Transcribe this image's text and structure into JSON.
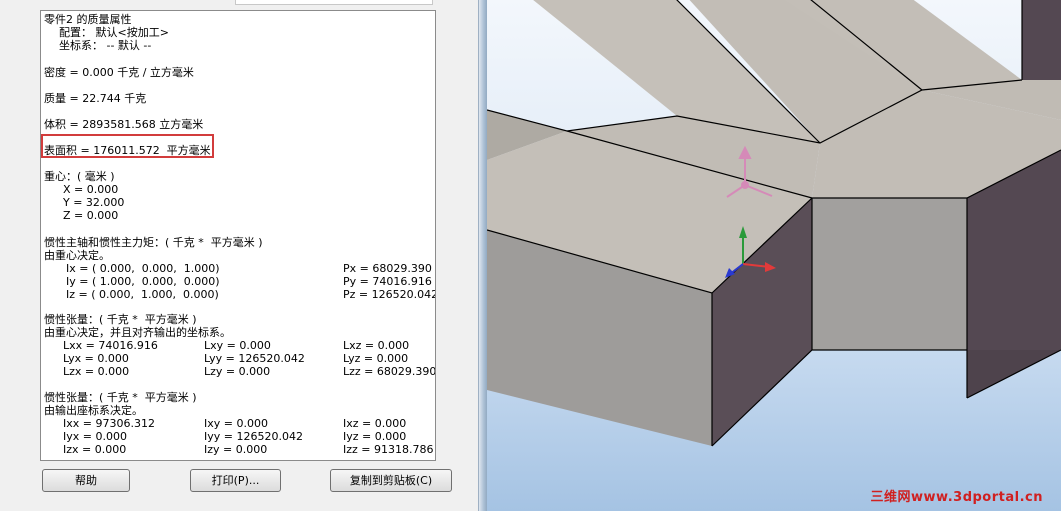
{
  "header": {
    "title": "零件2 的质量属性",
    "config_line": "配置： 默认<按加工>",
    "coord_line": "坐标系： -- 默认 --"
  },
  "properties": {
    "density": "密度 = 0.000 千克 / 立方毫米",
    "mass": "质量 = 22.744 千克",
    "volume": "体积 = 2893581.568 立方毫米",
    "surface_area": "表面积 = 176011.572  平方毫米"
  },
  "center_of_mass": {
    "title": "重心：( 毫米 )",
    "x": "X = 0.000",
    "y": "Y = 32.000",
    "z": "Z = 0.000"
  },
  "principal": {
    "title": "惯性主轴和惯性主力矩：( 千克 *  平方毫米 )",
    "note": "由重心决定。",
    "ix": "Ix = ( 0.000,  0.000,  1.000)",
    "iy": "Iy = ( 1.000,  0.000,  0.000)",
    "iz": "Iz = ( 0.000,  1.000,  0.000)",
    "px": "Px = 68029.390",
    "py": "Py = 74016.916",
    "pz": "Pz = 126520.042"
  },
  "tensor_com": {
    "title": "惯性张量：( 千克 *  平方毫米 )",
    "note": "由重心决定，并且对齐输出的坐标系。",
    "lxx": "Lxx = 74016.916",
    "lxy": "Lxy = 0.000",
    "lxz": "Lxz = 0.000",
    "lyx": "Lyx = 0.000",
    "lyy": "Lyy = 126520.042",
    "lyz": "Lyz = 0.000",
    "lzx": "Lzx = 0.000",
    "lzy": "Lzy = 0.000",
    "lzz": "Lzz = 68029.390"
  },
  "tensor_output": {
    "title": "惯性张量：( 千克 *  平方毫米 )",
    "note": "由输出座标系决定。",
    "ixx": "Ixx = 97306.312",
    "ixy": "Ixy = 0.000",
    "ixz": "Ixz = 0.000",
    "iyx": "Iyx = 0.000",
    "iyy": "Iyy = 126520.042",
    "iyz": "Iyz = 0.000",
    "izx": "Izx = 0.000",
    "izy": "Izy = 0.000",
    "izz": "Izz = 91318.786"
  },
  "buttons": {
    "help": "帮助",
    "print": "打印(P)...",
    "copy": "复制到剪贴板(C)"
  },
  "watermark": "三维网www.3dportal.cn",
  "colors": {
    "highlight": "#d23c3c",
    "face_top": "#c2bdb6",
    "face_dark": "#544852",
    "face_mid": "#9e9c9a",
    "axis_x": "#e23a3a",
    "axis_y": "#2a9a3a",
    "axis_z": "#2a3ad0",
    "triad": "#d58ab8"
  }
}
